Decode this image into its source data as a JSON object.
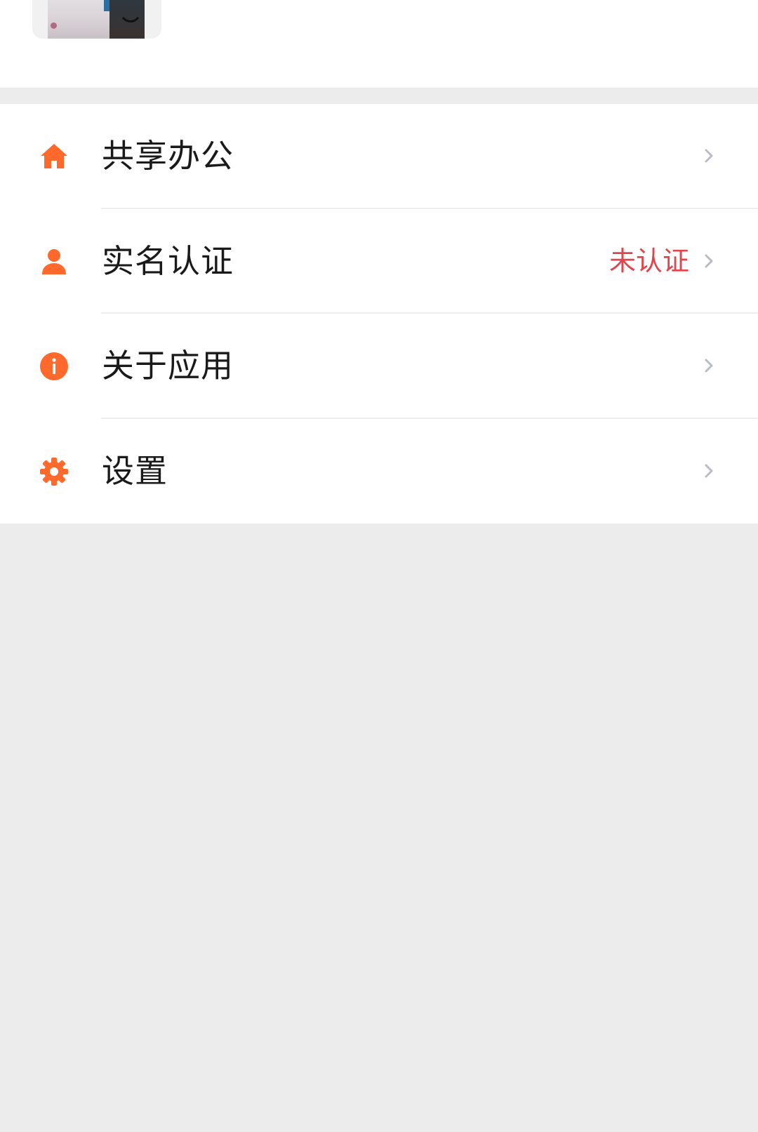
{
  "colors": {
    "accent": "#ff6a2c",
    "status_unverified": "#e0444c",
    "chevron": "#b9bcc2",
    "page_background": "#ececec"
  },
  "menu": {
    "items": [
      {
        "label": "共享办公",
        "icon": "home-icon",
        "status": ""
      },
      {
        "label": "实名认证",
        "icon": "user-icon",
        "status": "未认证"
      },
      {
        "label": "关于应用",
        "icon": "info-icon",
        "status": ""
      },
      {
        "label": "设置",
        "icon": "gear-icon",
        "status": ""
      }
    ]
  }
}
